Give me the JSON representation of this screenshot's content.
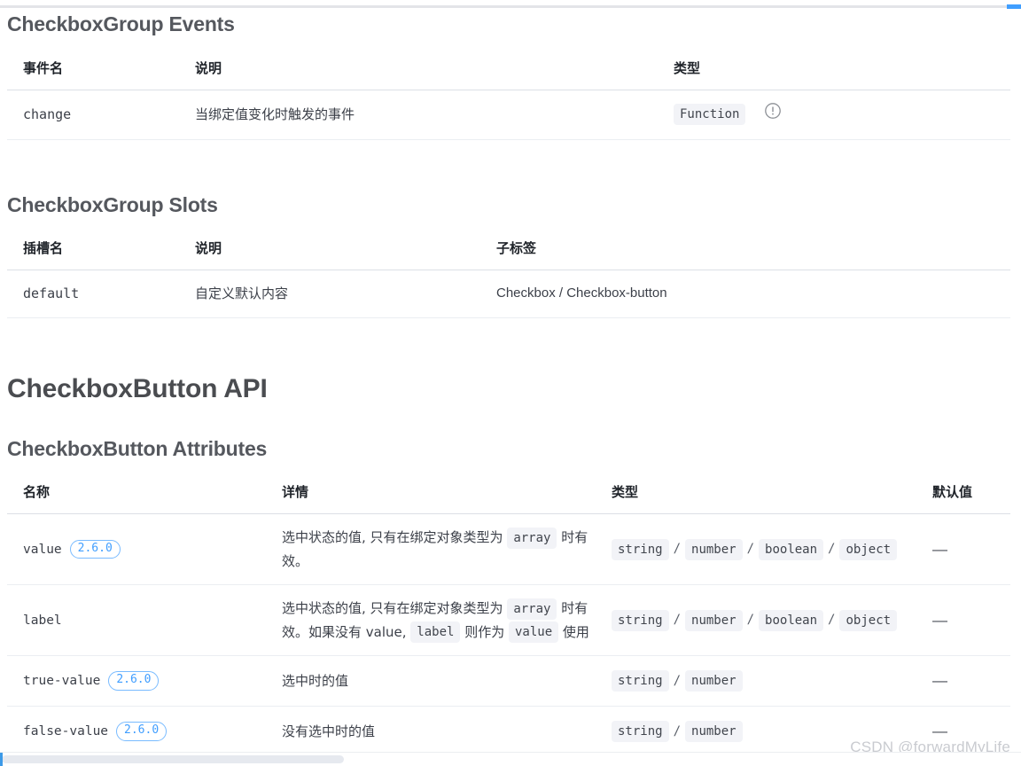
{
  "top_bar": {
    "indicator_color": "#409eff"
  },
  "sections": {
    "group_events": {
      "title": "CheckboxGroup Events",
      "headers": [
        "事件名",
        "说明",
        "类型"
      ],
      "rows": [
        {
          "name": "change",
          "desc": "当绑定值变化时触发的事件",
          "type_chips": [
            "Function"
          ],
          "has_warn_icon": true,
          "warn_icon": "exclamation-circle-icon"
        }
      ]
    },
    "group_slots": {
      "title": "CheckboxGroup Slots",
      "headers": [
        "插槽名",
        "说明",
        "子标签"
      ],
      "rows": [
        {
          "name": "default",
          "desc": "自定义默认内容",
          "subtags": "Checkbox / Checkbox-button"
        }
      ]
    },
    "button_api": {
      "title": "CheckboxButton API"
    },
    "button_attributes": {
      "title": "CheckboxButton Attributes",
      "headers": [
        "名称",
        "详情",
        "类型",
        "默认值"
      ],
      "rows": [
        {
          "name": "value",
          "version": "2.6.0",
          "detail_parts": [
            {
              "t": "text",
              "v": "选中状态的值, 只有在绑定对象类型为 "
            },
            {
              "t": "code",
              "v": "array"
            },
            {
              "t": "text",
              "v": " 时有效。"
            }
          ],
          "types": [
            "string",
            "number",
            "boolean",
            "object"
          ],
          "default": "—"
        },
        {
          "name": "label",
          "version": "",
          "detail_parts": [
            {
              "t": "text",
              "v": "选中状态的值, 只有在绑定对象类型为 "
            },
            {
              "t": "code",
              "v": "array"
            },
            {
              "t": "text",
              "v": " 时有效。如果没有 value, "
            },
            {
              "t": "code",
              "v": "label"
            },
            {
              "t": "text",
              "v": " 则作为 "
            },
            {
              "t": "code",
              "v": "value"
            },
            {
              "t": "text",
              "v": " 使用"
            }
          ],
          "types": [
            "string",
            "number",
            "boolean",
            "object"
          ],
          "default": "—"
        },
        {
          "name": "true-value",
          "version": "2.6.0",
          "detail_parts": [
            {
              "t": "text",
              "v": "选中时的值"
            }
          ],
          "types": [
            "string",
            "number"
          ],
          "default": "—"
        },
        {
          "name": "false-value",
          "version": "2.6.0",
          "detail_parts": [
            {
              "t": "text",
              "v": "没有选中时的值"
            }
          ],
          "types": [
            "string",
            "number"
          ],
          "default": "—"
        }
      ]
    }
  },
  "watermark": "CSDN @forwardMyLife"
}
